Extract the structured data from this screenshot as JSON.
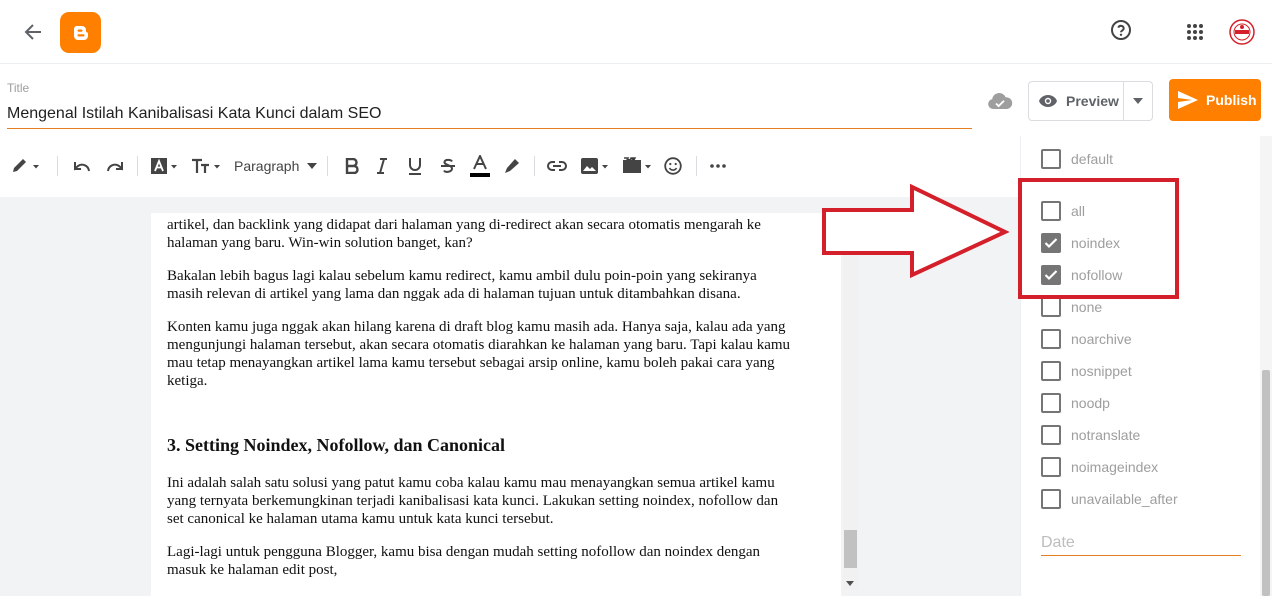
{
  "title_field": {
    "label": "Title",
    "value": "Mengenal Istilah Kanibalisasi Kata Kunci dalam SEO"
  },
  "actions": {
    "preview_label": "Preview",
    "publish_label": "Publish"
  },
  "toolbar": {
    "paragraph_label": "Paragraph"
  },
  "content": {
    "p1": [
      "artikel, dan backlink yang didapat dari halaman yang di-redirect akan secara otomatis mengarah ke",
      "halaman yang baru. Win-win solution banget, kan?"
    ],
    "p2": [
      "Bakalan lebih bagus lagi kalau sebelum kamu redirect, kamu ambil dulu poin-poin yang sekiranya",
      "masih relevan di artikel yang lama dan nggak ada di halaman tujuan untuk ditambahkan disana."
    ],
    "p3": [
      "Konten kamu juga nggak akan hilang karena di draft blog kamu masih ada. Hanya saja, kalau ada yang",
      "mengunjungi halaman tersebut, akan secara otomatis diarahkan ke halaman yang baru. Tapi kalau kamu",
      "mau tetap menayangkan artikel lama kamu tersebut sebagai arsip online, kamu boleh pakai cara yang",
      "ketiga."
    ],
    "heading": "3. Setting Noindex, Nofollow, dan Canonical",
    "p4": [
      "Ini adalah salah satu solusi yang patut kamu coba kalau kamu mau menayangkan semua artikel kamu",
      "yang ternyata berkemungkinan terjadi kanibalisasi kata kunci. Lakukan setting noindex, nofollow dan",
      "set canonical ke halaman utama kamu untuk kata kunci tersebut."
    ],
    "p5": [
      "Lagi-lagi untuk pengguna Blogger, kamu bisa dengan mudah setting nofollow dan noindex dengan",
      "masuk ke halaman edit post,"
    ]
  },
  "robots_options": [
    {
      "label": "default",
      "checked": false
    },
    {
      "label": "all",
      "checked": false
    },
    {
      "label": "noindex",
      "checked": true
    },
    {
      "label": "nofollow",
      "checked": true
    },
    {
      "label": "none",
      "checked": false
    },
    {
      "label": "noarchive",
      "checked": false
    },
    {
      "label": "nosnippet",
      "checked": false
    },
    {
      "label": "noodp",
      "checked": false
    },
    {
      "label": "notranslate",
      "checked": false
    },
    {
      "label": "noimageindex",
      "checked": false
    },
    {
      "label": "unavailable_after",
      "checked": false
    }
  ],
  "date_field": {
    "placeholder": "Date"
  },
  "colors": {
    "brand": "#ff8000",
    "annotation": "#d3202a",
    "checkbox": "#757575"
  }
}
